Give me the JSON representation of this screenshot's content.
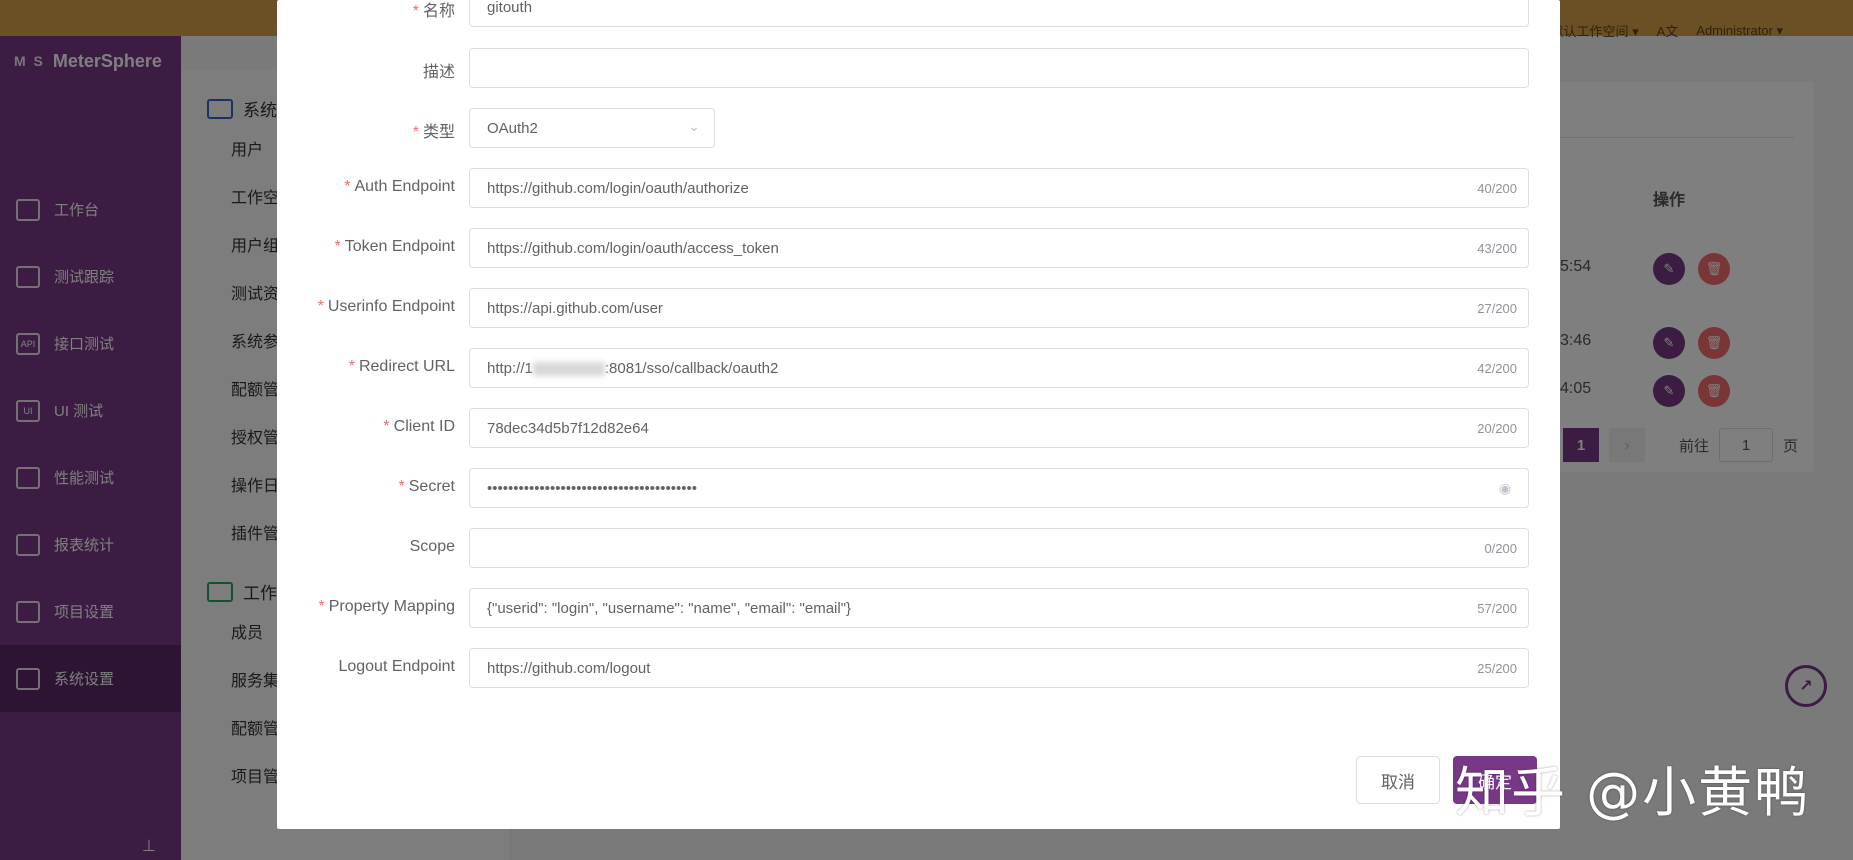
{
  "topbar": {
    "workspace": "默认工作空间",
    "lang": "A文",
    "user": "Administrator"
  },
  "sidebar": {
    "brand": "MeterSphere",
    "brand_mark": "M S",
    "items": [
      {
        "label": "工作台",
        "icon": "monitor-icon"
      },
      {
        "label": "测试跟踪",
        "icon": "clipboard-icon"
      },
      {
        "label": "接口测试",
        "icon": "api-icon"
      },
      {
        "label": "UI 测试",
        "icon": "ui-icon"
      },
      {
        "label": "性能测试",
        "icon": "chart-icon"
      },
      {
        "label": "报表统计",
        "icon": "report-icon"
      },
      {
        "label": "项目设置",
        "icon": "folder-icon"
      },
      {
        "label": "系统设置",
        "icon": "gears-icon"
      }
    ]
  },
  "subnav": {
    "group1": "系统",
    "group1_items": [
      "用户",
      "工作空",
      "用户组",
      "测试资",
      "系统参",
      "配额管",
      "授权管",
      "操作日",
      "插件管"
    ],
    "group2": "工作",
    "group2_items": [
      "成员",
      "服务集",
      "配额管",
      "项目管"
    ]
  },
  "table": {
    "op_header": "操作",
    "rows": [
      {
        "time": "5:54"
      },
      {
        "time": "3:46"
      },
      {
        "time": "4:05"
      }
    ],
    "pager": {
      "page": "1",
      "goto_label": "前往",
      "goto_value": "1",
      "page_suffix": "页"
    }
  },
  "dialog": {
    "fields": [
      {
        "label": "名称",
        "required": true,
        "value": "gitouth",
        "count": ""
      },
      {
        "label": "描述",
        "required": false,
        "value": "",
        "count": ""
      },
      {
        "label": "类型",
        "required": true,
        "value": "OAuth2",
        "count": ""
      },
      {
        "label": "Auth Endpoint",
        "required": true,
        "value": "https://github.com/login/oauth/authorize",
        "count": "40/200"
      },
      {
        "label": "Token Endpoint",
        "required": true,
        "value": "https://github.com/login/oauth/access_token",
        "count": "43/200"
      },
      {
        "label": "Userinfo Endpoint",
        "required": true,
        "value": "https://api.github.com/user",
        "count": "27/200"
      },
      {
        "label": "Redirect URL",
        "required": true,
        "value_prefix": "http://1",
        "value_suffix": ":8081/sso/callback/oauth2",
        "count": "42/200"
      },
      {
        "label": "Client ID",
        "required": true,
        "value": "78dec34d5b7f12d82e64",
        "count": "20/200"
      },
      {
        "label": "Secret",
        "required": true,
        "value": "••••••••••••••••••••••••••••••••••••••••",
        "count": ""
      },
      {
        "label": "Scope",
        "required": false,
        "value": "",
        "count": "0/200"
      },
      {
        "label": "Property Mapping",
        "required": true,
        "value": "{\"userid\": \"login\", \"username\": \"name\", \"email\": \"email\"}",
        "count": "57/200"
      },
      {
        "label": "Logout Endpoint",
        "required": false,
        "value": "https://github.com/logout",
        "count": "25/200"
      }
    ],
    "cancel_label": "取消",
    "confirm_label": "确定"
  },
  "watermark": "知乎 @小黄鸭",
  "colors": {
    "brand": "#783887",
    "required": "#f56c6c",
    "topbar": "#d9a04a"
  }
}
